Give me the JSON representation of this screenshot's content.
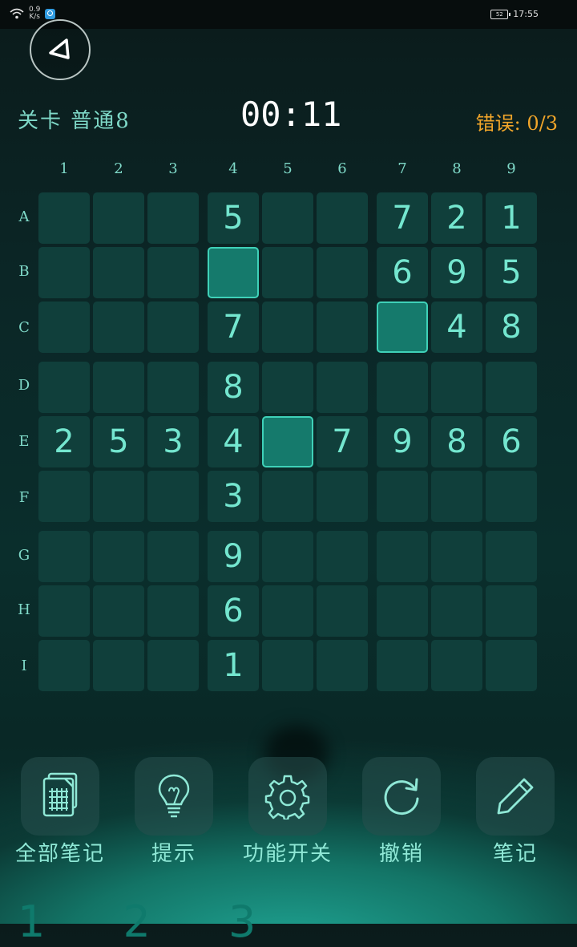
{
  "status_bar": {
    "net_speed_value": "0.9",
    "net_speed_unit": "K/s",
    "battery": "52",
    "time": "17:55"
  },
  "header": {
    "level": "关卡 普通8",
    "timer": "00:11",
    "errors": "错误: 0/3"
  },
  "columns": [
    "1",
    "2",
    "3",
    "4",
    "5",
    "6",
    "7",
    "8",
    "9"
  ],
  "rows": [
    "A",
    "B",
    "C",
    "D",
    "E",
    "F",
    "G",
    "H",
    "I"
  ],
  "grid": [
    [
      "",
      "",
      "",
      "5",
      "",
      "",
      "7",
      "2",
      "1"
    ],
    [
      "",
      "",
      "",
      "",
      "",
      "",
      "6",
      "9",
      "5"
    ],
    [
      "",
      "",
      "",
      "7",
      "",
      "",
      "",
      "4",
      "8"
    ],
    [
      "",
      "",
      "",
      "8",
      "",
      "",
      "",
      "",
      ""
    ],
    [
      "2",
      "5",
      "3",
      "4",
      "",
      "7",
      "9",
      "8",
      "6"
    ],
    [
      "",
      "",
      "",
      "3",
      "",
      "",
      "",
      "",
      ""
    ],
    [
      "",
      "",
      "",
      "9",
      "",
      "",
      "",
      "",
      ""
    ],
    [
      "",
      "",
      "",
      "6",
      "",
      "",
      "",
      "",
      ""
    ],
    [
      "",
      "",
      "",
      "1",
      "",
      "",
      "",
      "",
      ""
    ]
  ],
  "highlighted_cells": [
    "B4",
    "C7",
    "E5"
  ],
  "toolbar": [
    {
      "label": "全部笔记",
      "icon": "all-notes-icon"
    },
    {
      "label": "提示",
      "icon": "lightbulb-icon"
    },
    {
      "label": "功能开关",
      "icon": "gear-icon"
    },
    {
      "label": "撤销",
      "icon": "undo-icon"
    },
    {
      "label": "笔记",
      "icon": "pencil-icon"
    }
  ],
  "number_pad_partial": "1 2 3",
  "colors": {
    "accent": "#74e6cf",
    "cell": "#103f3b",
    "selected_cell": "#157a6c",
    "error_text": "#f0a52a"
  }
}
